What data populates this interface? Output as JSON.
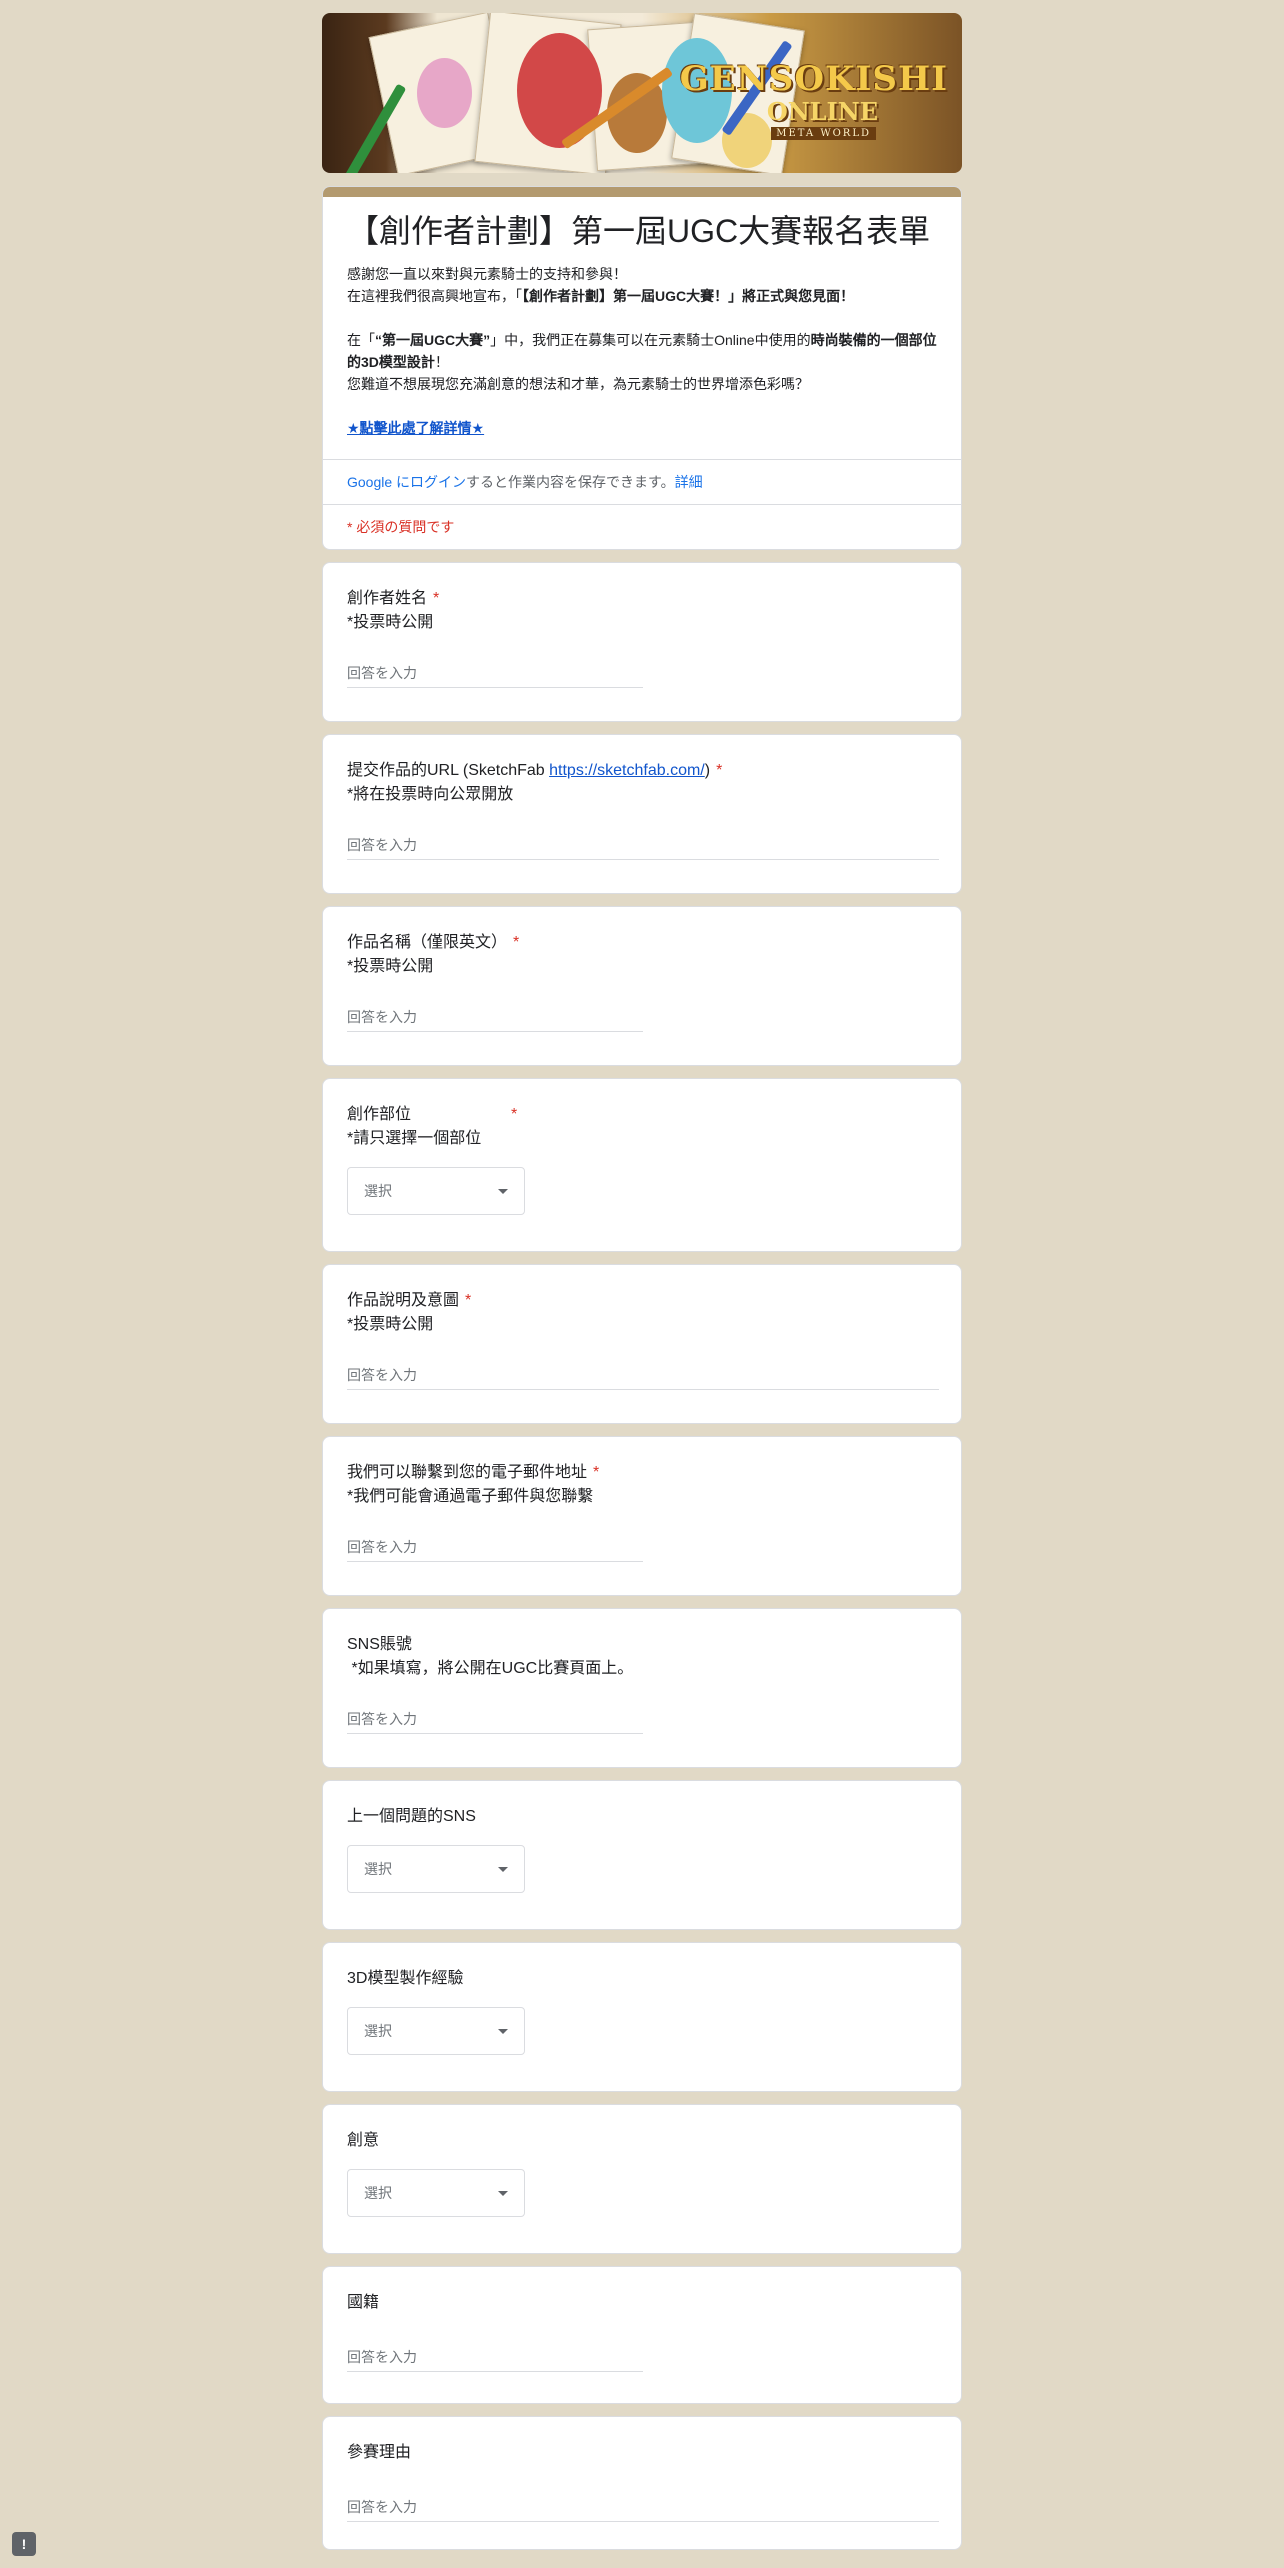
{
  "banner": {
    "logo_main": "GENSOKISHI",
    "logo_sub": "ONLINE",
    "logo_tag": "META WORLD"
  },
  "header": {
    "title": "【創作者計劃】第一屆UGC大賽報名表單",
    "desc_line1": "感謝您一直以來對與元素騎士的支持和參與！",
    "desc_line2_a": "在這裡我們很高興地宣布，「",
    "desc_line2_b": "【創作者計劃】第一屆UGC大賽！」將正式與您見面！",
    "desc_line3_a": "在「",
    "desc_line3_b": "“第一屆UGC大賽”",
    "desc_line3_c": "」中，我們正在募集可以在元素騎士Online中使用的",
    "desc_line3_d": "時尚裝備的一個部位的3D模型設計",
    "desc_line3_e": "！",
    "desc_line4": "您難道不想展現您充滿創意的想法和才華，為元素騎士的世界增添色彩嗎？",
    "details_link": "★點擊此處了解詳情★",
    "login_link": "Google にログイン",
    "login_text": "すると作業内容を保存できます。",
    "login_more": "詳細",
    "required_note": "* 必須の質問です"
  },
  "questions": [
    {
      "title": "創作者姓名",
      "sub": "*投票時公開",
      "required": "*",
      "placeholder": "回答を入力"
    },
    {
      "title_a": "提交作品的URL (SketchFab ",
      "link": "https://sketchfab.com/",
      "title_b": ")",
      "sub": "*將在投票時向公眾開放",
      "required": "*",
      "placeholder": "回答を入力"
    },
    {
      "title": "作品名稱（僅限英文）",
      "sub": "*投票時公開",
      "required": "*",
      "placeholder": "回答を入力"
    },
    {
      "title": "創作部位",
      "sub": "*請只選擇一個部位",
      "required": "*",
      "select": "選択"
    },
    {
      "title": "作品說明及意圖",
      "sub": "*投票時公開",
      "required": "*",
      "placeholder": "回答を入力"
    },
    {
      "title": "我們可以聯繫到您的電子郵件地址",
      "sub": "*我們可能會通過電子郵件與您聯繫",
      "required": "*",
      "placeholder": "回答を入力"
    },
    {
      "title": "SNS賬號",
      "sub": " *如果填寫，將公開在UGC比賽頁面上。",
      "placeholder": "回答を入力"
    },
    {
      "title": "上一個問題的SNS",
      "select": "選択"
    },
    {
      "title": "3D模型製作經驗",
      "select": "選択"
    },
    {
      "title": "創意",
      "select": "選択"
    },
    {
      "title": "國籍",
      "placeholder": "回答を入力"
    },
    {
      "title": "參賽理由",
      "placeholder": "回答を入力"
    }
  ],
  "feedback_icon": "!",
  "colors": {
    "background": "#e1d9c6",
    "accent_bar": "#b39a6f",
    "required": "#d93025",
    "link": "#1155cc"
  }
}
